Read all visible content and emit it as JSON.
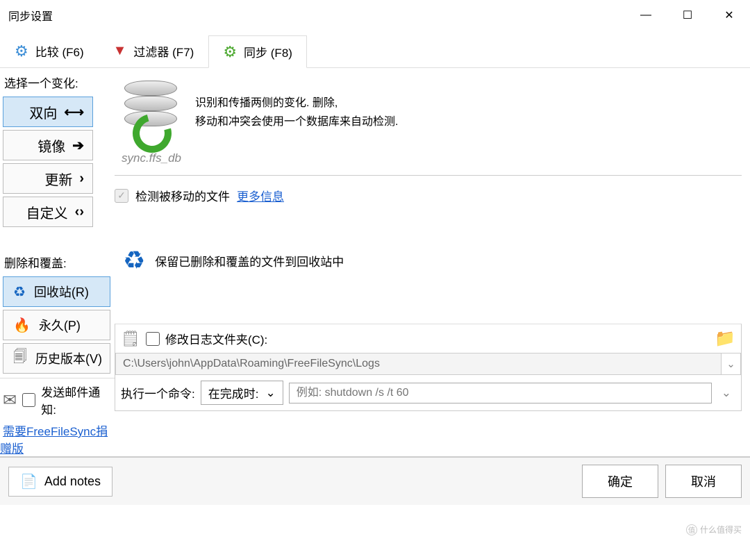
{
  "window": {
    "title": "同步设置"
  },
  "tabs": {
    "compare": "比较 (F6)",
    "filter": "过滤器 (F7)",
    "sync": "同步 (F8)"
  },
  "variant": {
    "section_label": "选择一个变化:",
    "twoway": "双向",
    "mirror": "镜像",
    "update": "更新",
    "custom": "自定义",
    "desc_line1": "识别和传播两侧的变化. 删除,",
    "desc_line2": "移动和冲突会使用一个数据库来自动检测.",
    "sync_db_file": "sync.ffs_db",
    "detect_moved": "检测被移动的文件",
    "more_info": "更多信息"
  },
  "delete": {
    "section_label": "删除和覆盖:",
    "recycle": "回收站(R)",
    "permanent": "永久(P)",
    "versioning": "历史版本(V)",
    "desc": "保留已删除和覆盖的文件到回收站中"
  },
  "mail": {
    "label": "发送邮件通知:",
    "donate_link": "需要FreeFileSync捐赠版"
  },
  "log": {
    "change_label": "修改日志文件夹(C):",
    "path": "C:\\Users\\john\\AppData\\Roaming\\FreeFileSync\\Logs"
  },
  "cmd": {
    "label": "执行一个命令:",
    "when": "在完成时:",
    "placeholder": "例如: shutdown /s /t 60"
  },
  "footer": {
    "add_notes": "Add notes",
    "ok": "确定",
    "cancel": "取消"
  },
  "watermark": "什么值得买"
}
